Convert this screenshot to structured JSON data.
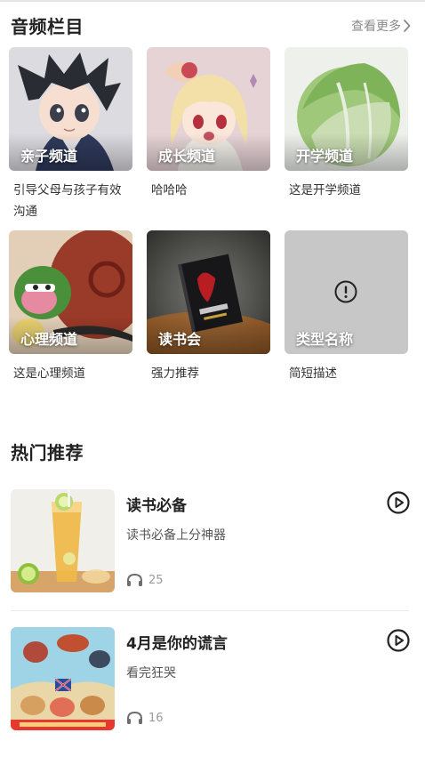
{
  "audio_section": {
    "title": "音频栏目",
    "more_label": "查看更多",
    "items": [
      {
        "label": "亲子频道",
        "desc": "引导父母与孩子有效沟通"
      },
      {
        "label": "成长频道",
        "desc": "哈哈哈"
      },
      {
        "label": "开学频道",
        "desc": "这是开学频道"
      },
      {
        "label": "心理频道",
        "desc": "这是心理频道"
      },
      {
        "label": "读书会",
        "desc": "强力推荐"
      },
      {
        "label": "类型名称",
        "desc": "简短描述",
        "placeholder_icon": "alert-circle-icon"
      }
    ]
  },
  "hot_section": {
    "title": "热门推荐",
    "items": [
      {
        "title": "读书必备",
        "subtitle": "读书必备上分神器",
        "listens": "25",
        "icon": "play-circle-icon"
      },
      {
        "title": "4月是你的谎言",
        "subtitle": "看完狂哭",
        "listens": "16",
        "icon": "play-circle-icon"
      }
    ]
  },
  "colors": {
    "text_primary": "#222222",
    "text_secondary": "#8a8a8a",
    "placeholder_bg": "#c7c7c7"
  }
}
